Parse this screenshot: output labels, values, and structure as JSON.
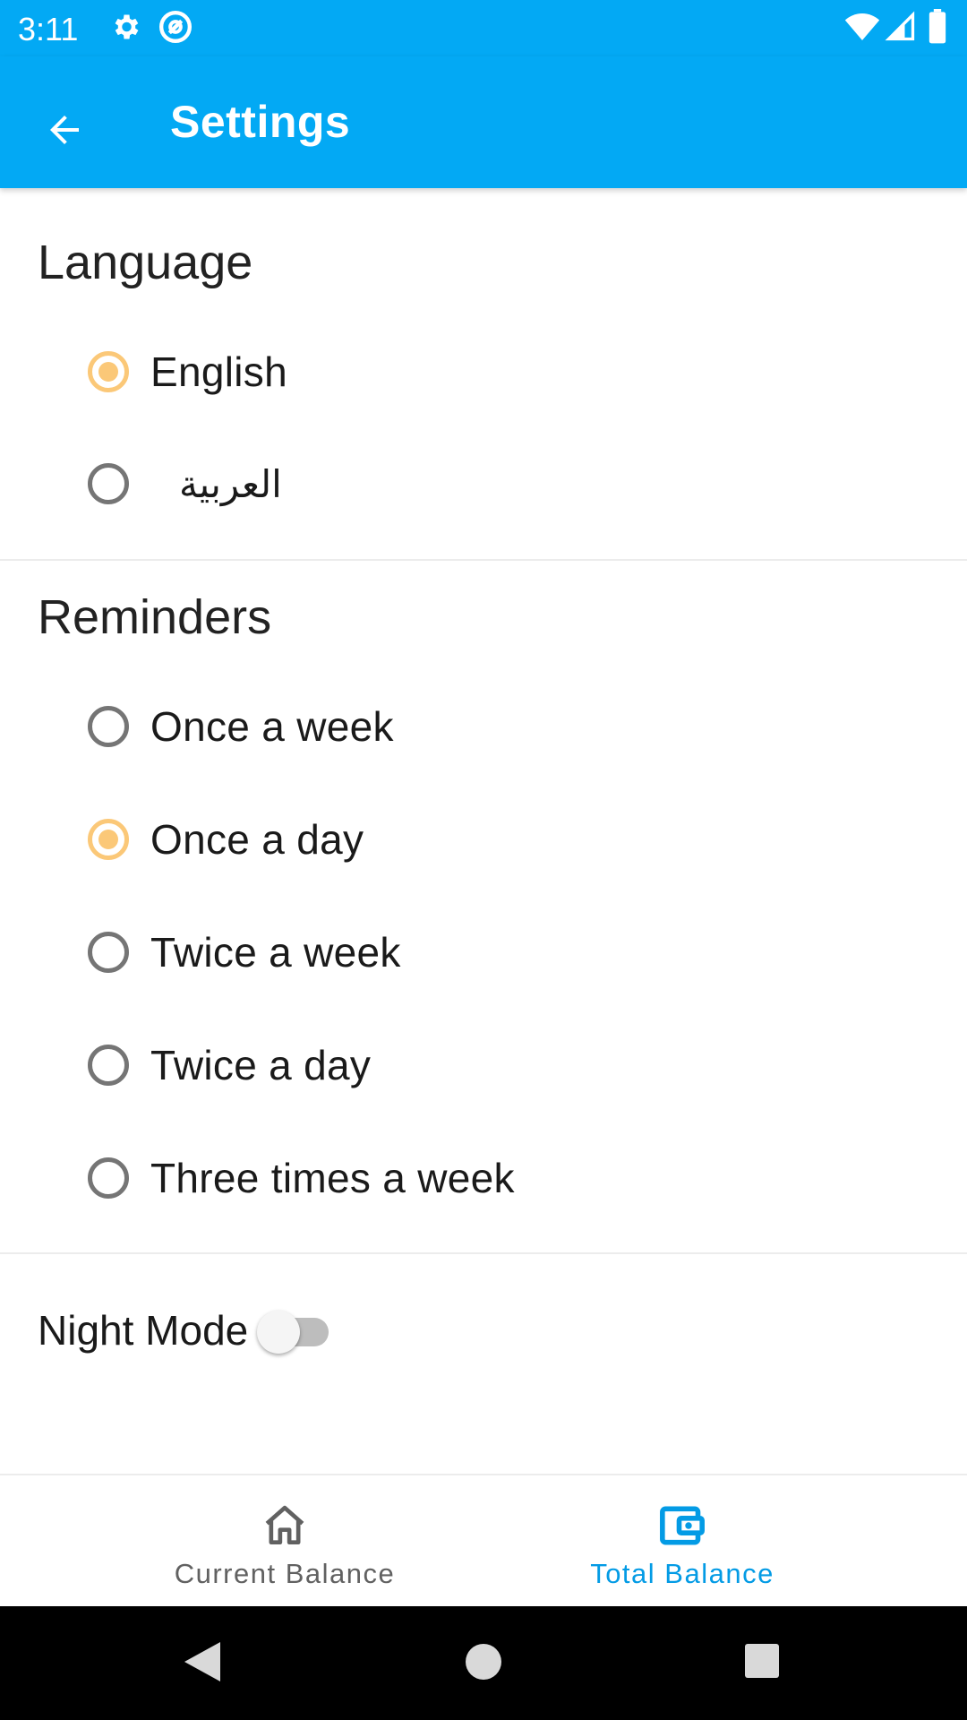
{
  "status_bar": {
    "time": "3:11",
    "icons": [
      "gear-icon",
      "at-sign-icon",
      "wifi-icon",
      "signal-icon",
      "battery-icon"
    ]
  },
  "app_bar": {
    "title": "Settings",
    "back_icon": "arrow-left-icon",
    "background": "#03A9F4"
  },
  "language": {
    "title": "Language",
    "options": [
      {
        "label": "English",
        "checked": true
      },
      {
        "label": "العربية",
        "checked": false
      }
    ]
  },
  "reminders": {
    "title": "Reminders",
    "options": [
      {
        "label": "Once a week",
        "checked": false
      },
      {
        "label": "Once a day",
        "checked": true
      },
      {
        "label": "Twice a week",
        "checked": false
      },
      {
        "label": "Twice a day",
        "checked": false
      },
      {
        "label": "Three times a week",
        "checked": false
      }
    ]
  },
  "night_mode": {
    "label": "Night Mode",
    "enabled": false
  },
  "bottom_nav": {
    "items": [
      {
        "label": "Current Balance",
        "icon": "home-icon",
        "active": false
      },
      {
        "label": "Total Balance",
        "icon": "wallet-icon",
        "active": true
      }
    ],
    "active_color": "#039BE5",
    "inactive_color": "#616161"
  },
  "system_nav": {
    "icons": [
      "back-triangle-icon",
      "home-circle-icon",
      "recents-square-icon"
    ]
  },
  "colors": {
    "accent": "#FBC878",
    "primary": "#03A9F4"
  }
}
